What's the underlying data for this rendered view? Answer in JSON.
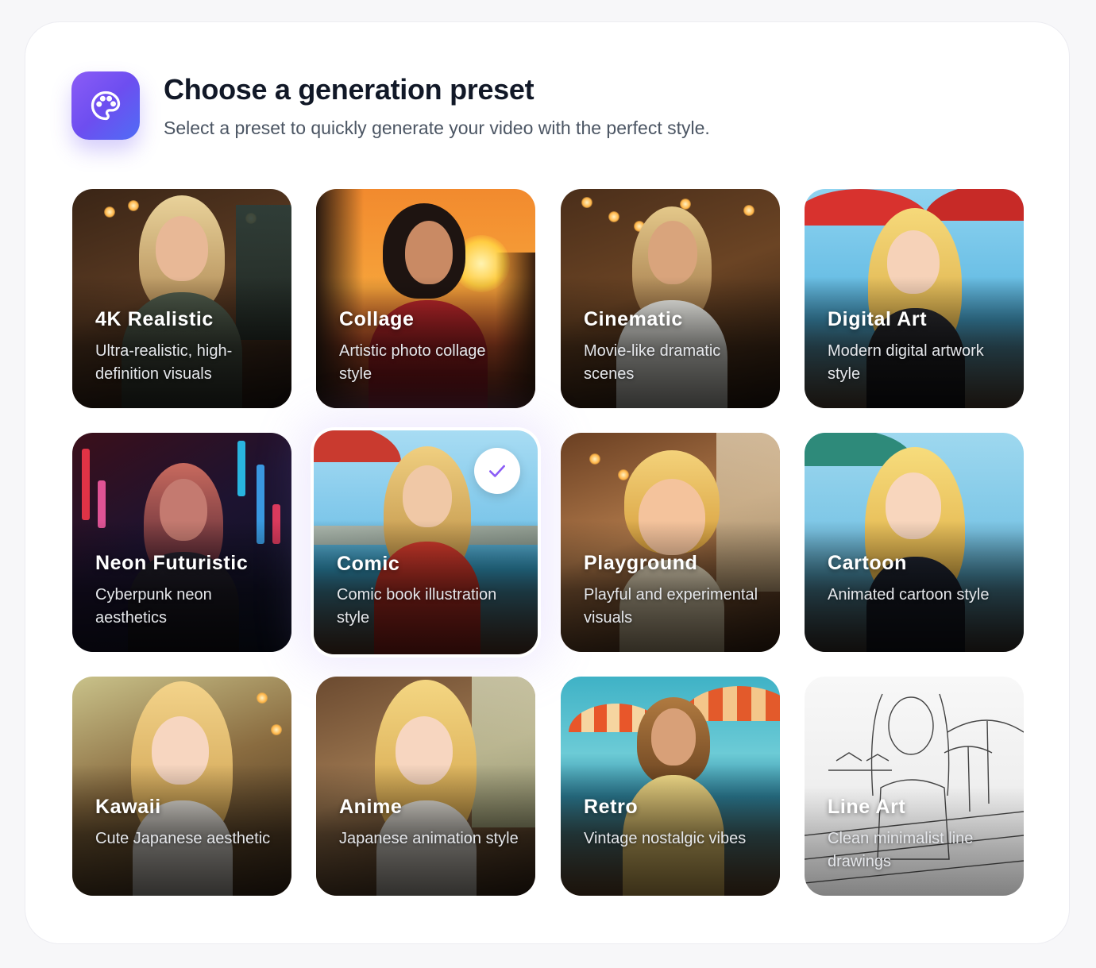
{
  "header": {
    "title": "Choose a generation preset",
    "subtitle": "Select a preset to quickly generate your video with the perfect style.",
    "icon": "palette-icon",
    "accent_gradient": [
      "#8b5cf6",
      "#4f6df5"
    ]
  },
  "selected_preset": "Comic",
  "presets": [
    {
      "name": "4K Realistic",
      "description": "Ultra-realistic, high-definition visuals"
    },
    {
      "name": "Collage",
      "description": "Artistic photo collage style"
    },
    {
      "name": "Cinematic",
      "description": "Movie-like dramatic scenes"
    },
    {
      "name": "Digital Art",
      "description": "Modern digital artwork style"
    },
    {
      "name": "Neon Futuristic",
      "description": "Cyberpunk neon aesthetics"
    },
    {
      "name": "Comic",
      "description": "Comic book illustration style",
      "selected": true
    },
    {
      "name": "Playground",
      "description": "Playful and experimental visuals"
    },
    {
      "name": "Cartoon",
      "description": "Animated cartoon style"
    },
    {
      "name": "Kawaii",
      "description": "Cute Japanese aesthetic"
    },
    {
      "name": "Anime",
      "description": "Japanese animation style"
    },
    {
      "name": "Retro",
      "description": "Vintage nostalgic vibes"
    },
    {
      "name": "Line Art",
      "description": "Clean minimalist line drawings"
    }
  ]
}
